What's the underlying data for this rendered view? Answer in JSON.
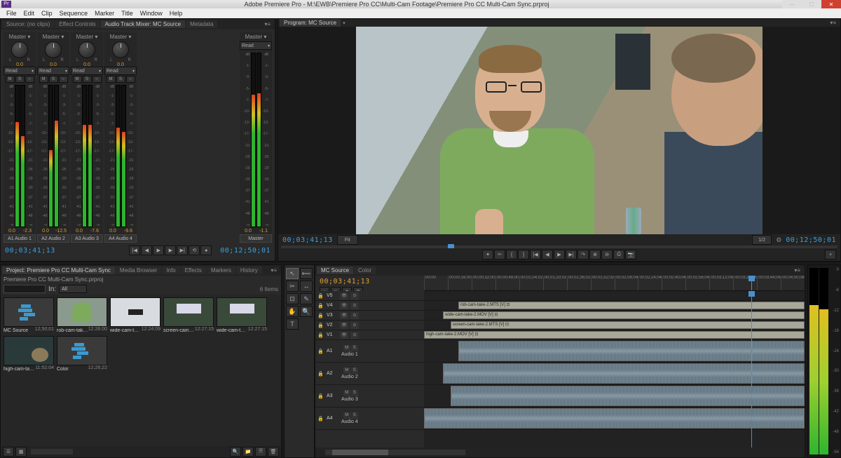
{
  "window": {
    "title": "Adobe Premiere Pro - M:\\EWB\\Premiere Pro CC\\Multi-Cam Footage\\Premiere Pro CC Multi-Cam Sync.prproj",
    "app_icon": "Pr"
  },
  "menu": {
    "items": [
      "File",
      "Edit",
      "Clip",
      "Sequence",
      "Marker",
      "Title",
      "Window",
      "Help"
    ]
  },
  "source_tabs": {
    "t1": "Source: (no clips)",
    "t2": "Effect Controls",
    "t3": "Audio Track Mixer: MC Source",
    "t4": "Metadata"
  },
  "mixer": {
    "channels": [
      {
        "name": "Master",
        "pan": "0.0",
        "mode": "Read",
        "db1": "0.0",
        "db2": "-2.3",
        "route": "Audio 1",
        "tag": "A1",
        "h1": 74,
        "h2": 64
      },
      {
        "name": "Master",
        "pan": "0.0",
        "mode": "Read",
        "db1": "0.0",
        "db2": "-12.5",
        "route": "Audio 2",
        "tag": "A2",
        "h1": 54,
        "h2": 75
      },
      {
        "name": "Master",
        "pan": "0.0",
        "mode": "Read",
        "db1": "0.0",
        "db2": "-7.6",
        "route": "Audio 3",
        "tag": "A3",
        "h1": 72,
        "h2": 72
      },
      {
        "name": "Master",
        "pan": "0.0",
        "mode": "Read",
        "db1": "0.0",
        "db2": "-9.6",
        "route": "Audio 4",
        "tag": "A4",
        "h1": 70,
        "h2": 67
      }
    ],
    "master": {
      "name": "Master",
      "mode": "Read",
      "db1": "0.0",
      "db2": "-1.1",
      "route": "Master",
      "h1": 76,
      "h2": 77
    },
    "ticks": [
      "dB",
      "-1-",
      "-3-",
      "-5-",
      "-7-",
      "-10-",
      "-13-",
      "-17-",
      "-21",
      "-25",
      "-29",
      "-33",
      "-37",
      "-41",
      "-48",
      "-∞"
    ],
    "timecode": "00;03;41;13",
    "duration": "00;12;50;01",
    "lr": {
      "l": "L",
      "r": "R"
    }
  },
  "program": {
    "tab": "Program: MC Source",
    "timecode": "00;03;41;13",
    "duration": "00;12;50;01",
    "fit": "Fit",
    "half": "1/2"
  },
  "project": {
    "tab": "Project: Premiere Pro CC Multi-Cam Sync",
    "tabs": {
      "mb": "Media Browser",
      "info": "Info",
      "fx": "Effects",
      "mk": "Markers",
      "hist": "History"
    },
    "subtab": "Premiere Pro CC Multi-Cam Sync.prproj",
    "filter_in": "In:",
    "filter_all": "All",
    "count": "6 Items",
    "bins": [
      {
        "name": "MC Source",
        "dur": "12;50;01",
        "kind": "seq"
      },
      {
        "name": "rob-cam-take-2...",
        "dur": "12:26:00",
        "kind": "rob"
      },
      {
        "name": "wide-cam-take-2...",
        "dur": "12:24:09",
        "kind": "wide"
      },
      {
        "name": "screen-cam-take-2...",
        "dur": "12:27:15",
        "kind": "screen"
      },
      {
        "name": "wide-cam-take-2...",
        "dur": "12:27:15",
        "kind": "screen2"
      },
      {
        "name": "high-cam-take-2...",
        "dur": "11:52:04",
        "kind": "high"
      },
      {
        "name": "Color",
        "dur": "12;26;22",
        "kind": "seq"
      }
    ]
  },
  "tools": [
    "↖",
    "⟵",
    "✂",
    "↔",
    "⊡",
    "✎",
    "✋",
    "🔍",
    "T"
  ],
  "timeline": {
    "tab": "MC Source",
    "tab2": "Color",
    "timecode": "00;03;41;13",
    "ruler": [
      "00;00",
      "00;00;16;00",
      "00;00;32;00",
      "00;00;48;00",
      "00;01;04;02",
      "00;01;20;02",
      "00;01;36;02",
      "00;01;52;02",
      "00;02;08;04",
      "00;02;24;04",
      "00;02;40;04",
      "00;02;56;04",
      "00;03;12;06",
      "00;03;28;06",
      "00;03;44;06",
      "00;04;00;08"
    ],
    "playhead_pct": 86,
    "video_tracks": [
      {
        "tag": "V5",
        "clip": null
      },
      {
        "tag": "V4",
        "clip": {
          "name": "rob-cam-take-2.MTS [V]",
          "start": 9,
          "len": 91
        }
      },
      {
        "tag": "V3",
        "clip": {
          "name": "wide-cam-take-2.MOV [V]",
          "start": 5,
          "len": 95
        }
      },
      {
        "tag": "V2",
        "clip": {
          "name": "screen-cam-take-2.MTS [V]",
          "start": 7,
          "len": 93
        }
      },
      {
        "tag": "V1",
        "clip": {
          "name": "high-cam-take-2.MOV [V]",
          "start": 0,
          "len": 100
        }
      }
    ],
    "audio_tracks": [
      {
        "tag": "A1",
        "name": "Audio 1",
        "clip": {
          "start": 9,
          "len": 91
        }
      },
      {
        "tag": "A2",
        "name": "Audio 2",
        "clip": {
          "start": 5,
          "len": 95
        }
      },
      {
        "tag": "A3",
        "name": "Audio 3",
        "clip": {
          "start": 7,
          "len": 93
        }
      },
      {
        "tag": "A4",
        "name": "Audio 4",
        "clip": {
          "start": 0,
          "len": 100
        }
      }
    ]
  },
  "master_meter": {
    "ticks": [
      "0",
      "-6",
      "-12",
      "-18",
      "-24",
      "-30",
      "-36",
      "-42",
      "-48",
      "-54"
    ],
    "h1": 80,
    "h2": 78
  },
  "transport_icons": {
    "rec": "●",
    "prev": "▮◀",
    "play": "▶",
    "next": "▶▮",
    "loop": "⟲"
  },
  "prog_btns": [
    "✦",
    "✂",
    "{",
    "}",
    "|◀",
    "◀",
    "▶",
    "▶|",
    "↷",
    "⊕",
    "⊖",
    "⎙",
    "📷",
    "+"
  ]
}
